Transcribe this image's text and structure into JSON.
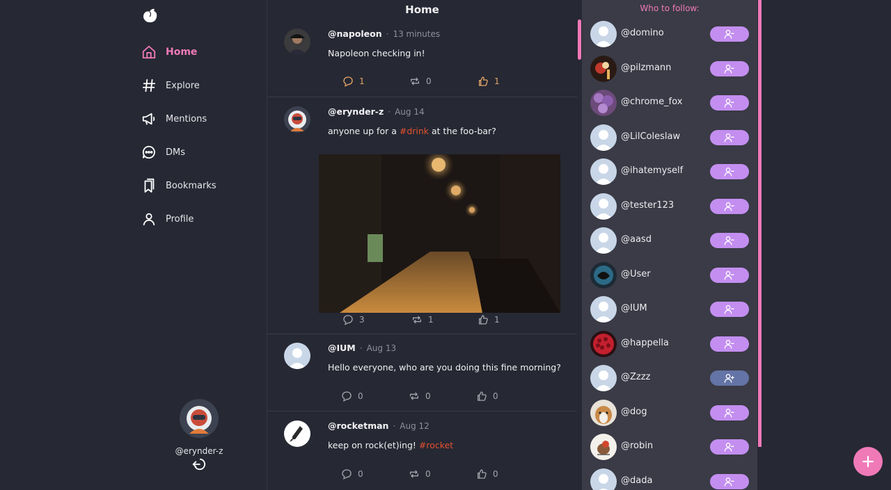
{
  "feed": {
    "title": "Home"
  },
  "nav": {
    "items": [
      {
        "label": "Home",
        "icon": "home-icon",
        "active": true
      },
      {
        "label": "Explore",
        "icon": "hashtag-icon"
      },
      {
        "label": "Mentions",
        "icon": "megaphone-icon"
      },
      {
        "label": "DMs",
        "icon": "chat-bubble-icon"
      },
      {
        "label": "Bookmarks",
        "icon": "bookmark-icon"
      },
      {
        "label": "Profile",
        "icon": "user-icon"
      }
    ]
  },
  "current_user": {
    "handle": "@erynder-z"
  },
  "posts": [
    {
      "handle": "@napoleon",
      "time": "13 minutes",
      "text": "Napoleon checking in!",
      "comments": "1",
      "reposts": "0",
      "likes": "1"
    },
    {
      "handle": "@erynder-z",
      "time": "Aug 14",
      "text_before": "anyone up for a ",
      "tag": "#drink",
      "text_after": " at the foo-bar?",
      "comments": "3",
      "reposts": "1",
      "likes": "1"
    },
    {
      "handle": "@IUM",
      "time": "Aug 13",
      "text": "Hello everyone, who are you doing this fine morning?",
      "comments": "0",
      "reposts": "0",
      "likes": "0"
    },
    {
      "handle": "@rocketman",
      "time": "Aug 12",
      "text_before": "keep on rock(et)ing! ",
      "tag": "#rocket",
      "comments": "0",
      "reposts": "0",
      "likes": "0"
    }
  ],
  "who_to_follow": {
    "title": "Who to follow:",
    "users": [
      {
        "handle": "@domino",
        "state": "following"
      },
      {
        "handle": "@pilzmann",
        "state": "following"
      },
      {
        "handle": "@chrome_fox",
        "state": "following"
      },
      {
        "handle": "@LilColeslaw",
        "state": "following"
      },
      {
        "handle": "@ihatemyself",
        "state": "following"
      },
      {
        "handle": "@tester123",
        "state": "following"
      },
      {
        "handle": "@aasd",
        "state": "following"
      },
      {
        "handle": "@User",
        "state": "following"
      },
      {
        "handle": "@IUM",
        "state": "following"
      },
      {
        "handle": "@happella",
        "state": "following"
      },
      {
        "handle": "@Zzzz",
        "state": "not-following"
      },
      {
        "handle": "@dog",
        "state": "following"
      },
      {
        "handle": "@robin",
        "state": "following"
      },
      {
        "handle": "@dada",
        "state": "following"
      }
    ]
  },
  "colors": {
    "accent": "#f07ab8",
    "background": "#262833",
    "panel": "#3a3b46",
    "unfollow_button": "#c38ef0",
    "follow_button": "#6474a6",
    "hashtag": "#e4502f",
    "highlight_action": "#e6a56a"
  }
}
